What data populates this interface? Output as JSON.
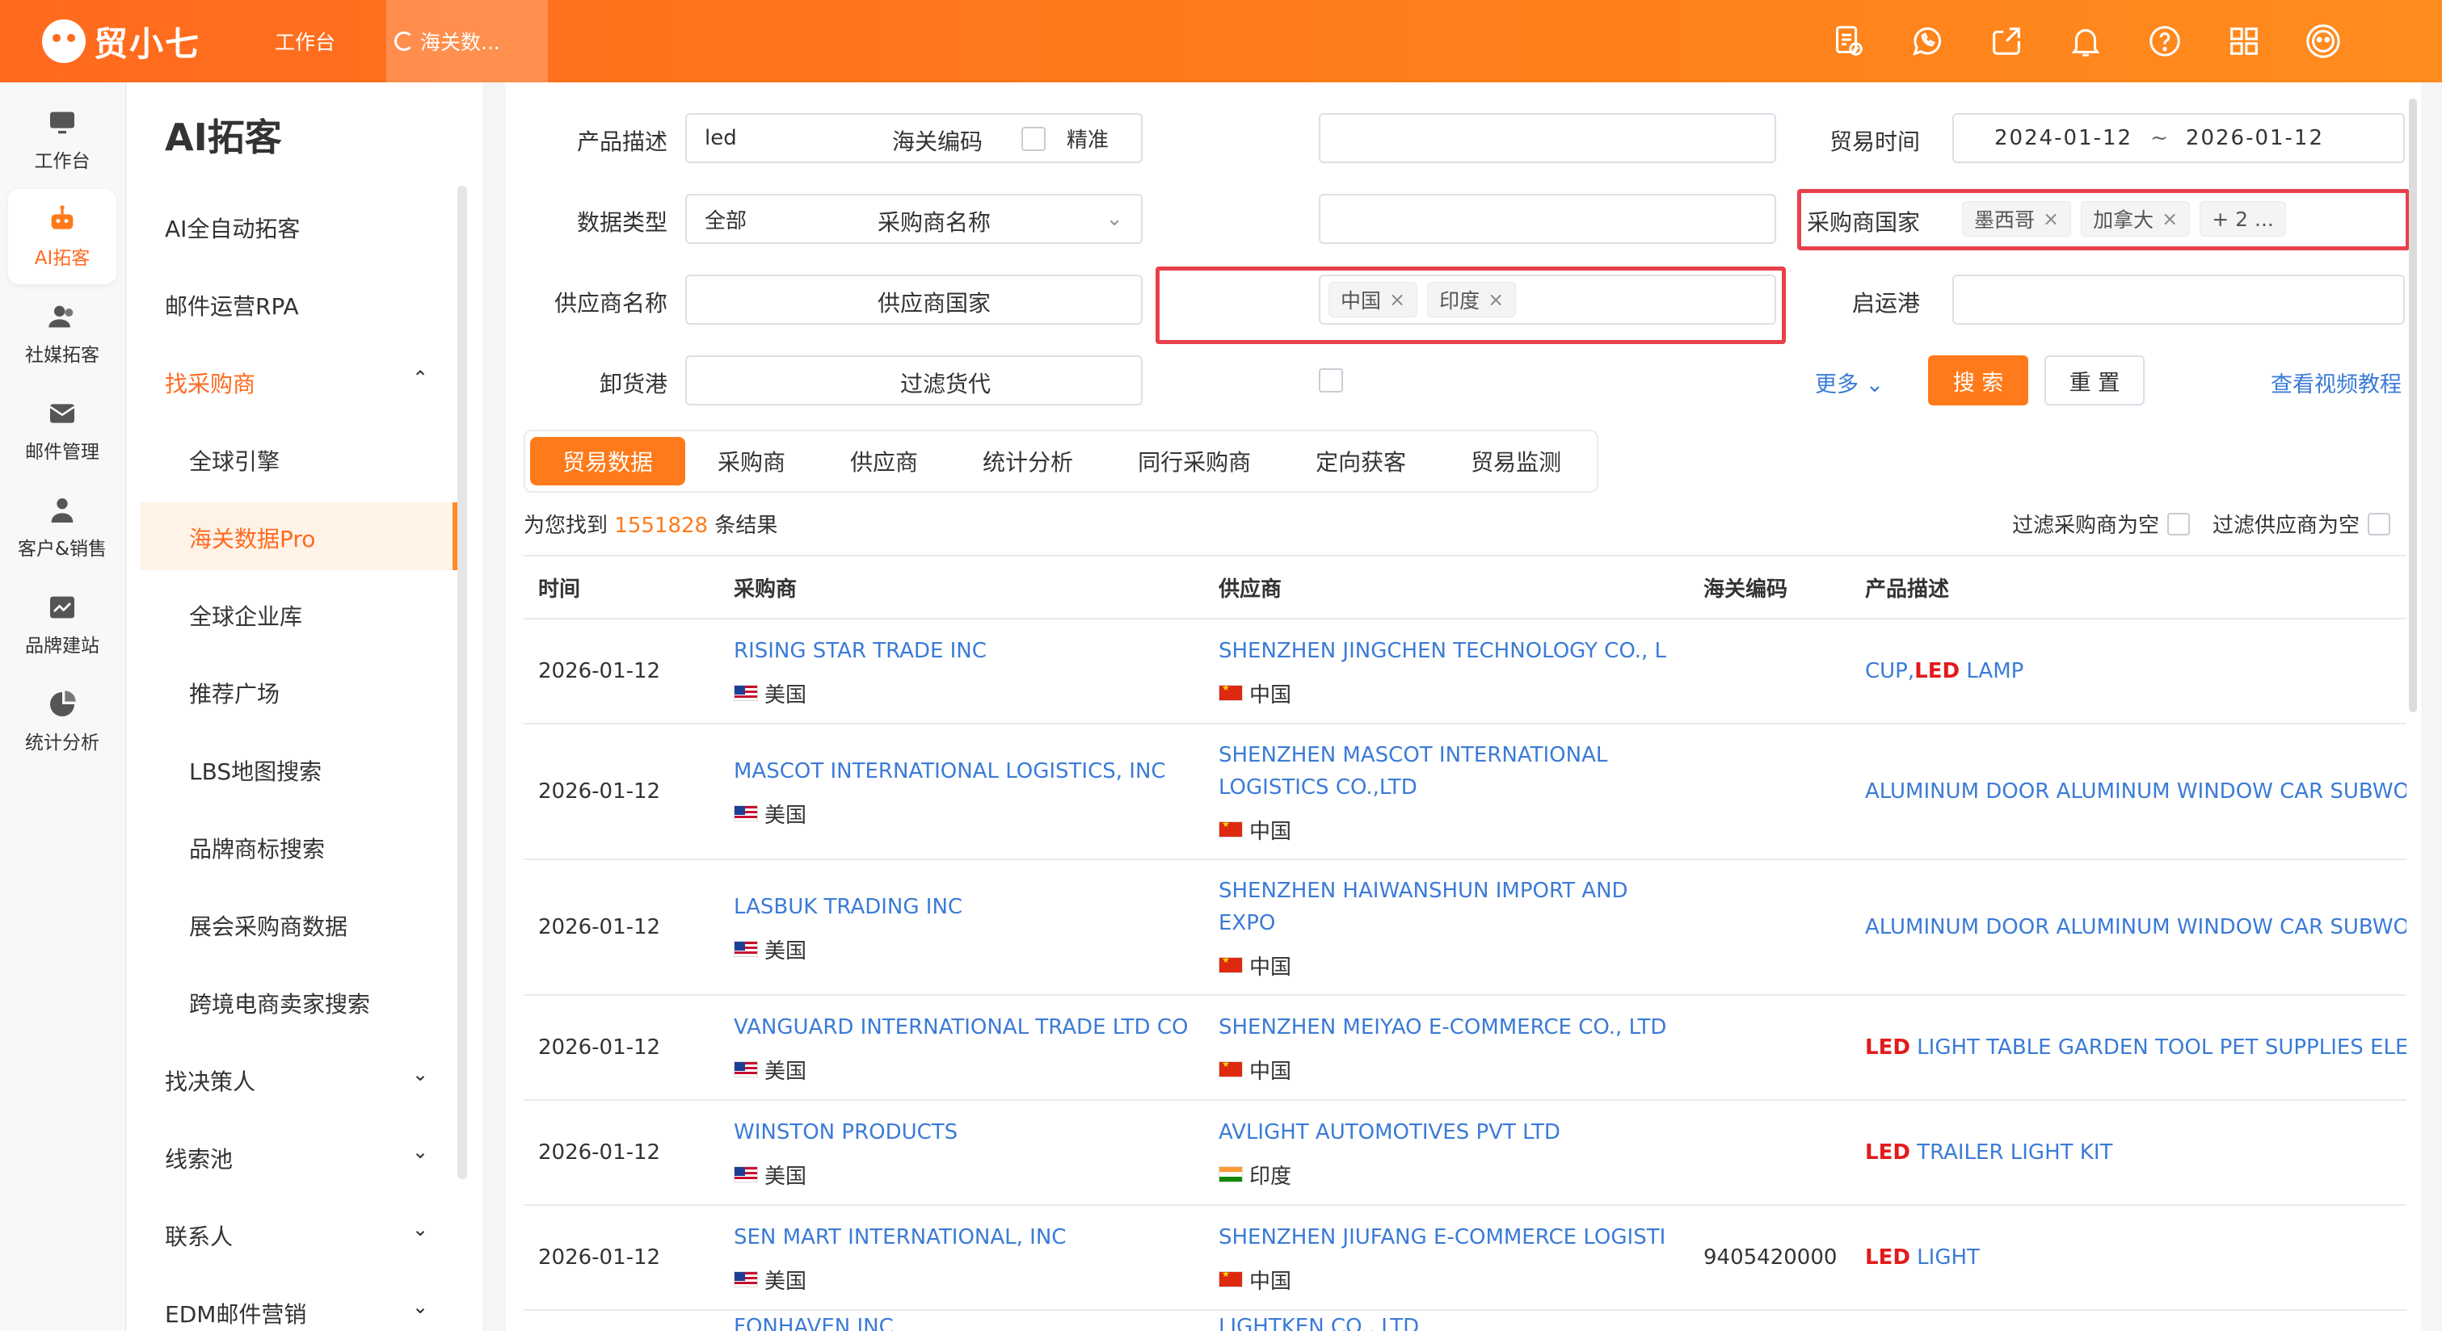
{
  "app": {
    "brand": "贸小七",
    "tabs": [
      "工作台",
      "海关数..."
    ]
  },
  "colors": {
    "accent": "#ff7a1a",
    "link": "#3b7bd6",
    "highlight": "#e21b1b",
    "redbox": "#e8414b"
  },
  "topbar_icons": [
    "document-check-icon",
    "whatsapp-icon",
    "share-icon",
    "bell-icon",
    "help-icon",
    "grid-apps-icon",
    "avatar-icon"
  ],
  "rail": [
    {
      "label": "工作台",
      "icon": "monitor-icon"
    },
    {
      "label": "AI拓客",
      "icon": "robot-icon",
      "active": true
    },
    {
      "label": "社媒拓客",
      "icon": "users-icon"
    },
    {
      "label": "邮件管理",
      "icon": "mail-icon"
    },
    {
      "label": "客户&销售",
      "icon": "customer-icon"
    },
    {
      "label": "品牌建站",
      "icon": "site-icon"
    },
    {
      "label": "统计分析",
      "icon": "pie-chart-icon"
    }
  ],
  "subnav": {
    "title": "AI拓客",
    "items": [
      {
        "label": "AI全自动拓客"
      },
      {
        "label": "邮件运营RPA"
      },
      {
        "label": "找采购商",
        "expanded": true
      },
      {
        "label": "全球引擎"
      },
      {
        "label": "海关数据Pro"
      },
      {
        "label": "全球企业库"
      },
      {
        "label": "推荐广场"
      },
      {
        "label": "LBS地图搜索"
      },
      {
        "label": "品牌商标搜索"
      },
      {
        "label": "展会采购商数据"
      },
      {
        "label": "跨境电商卖家搜索"
      },
      {
        "label": "找决策人"
      },
      {
        "label": "线索池"
      },
      {
        "label": "联系人"
      },
      {
        "label": "EDM邮件营销"
      }
    ]
  },
  "filters": {
    "product_desc": {
      "label": "产品描述",
      "value": "led",
      "exact_label": "精准"
    },
    "hs_code": {
      "label": "海关编码",
      "value": ""
    },
    "trade_time": {
      "label": "贸易时间",
      "start": "2024-01-12",
      "sep": "~",
      "end": "2026-01-12"
    },
    "data_type": {
      "label": "数据类型",
      "value": "全部"
    },
    "buyer_name": {
      "label": "采购商名称",
      "value": ""
    },
    "buyer_country": {
      "label": "采购商国家",
      "tags": [
        "墨西哥",
        "加拿大"
      ],
      "more": "+ 2 ..."
    },
    "supplier_name": {
      "label": "供应商名称",
      "value": ""
    },
    "supplier_country": {
      "label": "供应商国家",
      "tags": [
        "中国",
        "印度"
      ]
    },
    "departure_port": {
      "label": "启运港",
      "value": ""
    },
    "unloading_port": {
      "label": "卸货港",
      "value": ""
    },
    "filter_forwarder": {
      "label": "过滤货代"
    },
    "more": "更多",
    "search": "搜 索",
    "reset": "重 置",
    "video": "查看视频教程"
  },
  "tabs": [
    "贸易数据",
    "采购商",
    "供应商",
    "统计分析",
    "同行采购商",
    "定向获客",
    "贸易监测"
  ],
  "result": {
    "prefix": "为您找到",
    "count": "1551828",
    "suffix": "条结果"
  },
  "filter_empty": {
    "buyer": "过滤采购商为空",
    "supplier": "过滤供应商为空"
  },
  "table": {
    "headers": [
      "时间",
      "采购商",
      "供应商",
      "海关编码",
      "产品描述"
    ],
    "rows": [
      {
        "date": "2026-01-12",
        "buyer": "RISING STAR TRADE INC",
        "buyer_country": "美国",
        "buyer_flag": "us",
        "supplier": "SHENZHEN JINGCHEN TECHNOLOGY CO., L",
        "supplier_country": "中国",
        "supplier_flag": "cn",
        "hs": "",
        "desc": [
          {
            "t": "CUP,",
            "hl": false
          },
          {
            "t": "LED",
            "hl": true
          },
          {
            "t": " LAMP",
            "hl": false
          }
        ]
      },
      {
        "date": "2026-01-12",
        "buyer": "MASCOT INTERNATIONAL LOGISTICS, INC",
        "buyer_country": "美国",
        "buyer_flag": "us",
        "supplier": "SHENZHEN MASCOT INTERNATIONAL LOGISTICS CO.,LTD",
        "supplier_country": "中国",
        "supplier_flag": "cn",
        "hs": "",
        "desc": [
          {
            "t": "ALUMINUM DOOR ALUMINUM WINDOW CAR SUBWOO",
            "hl": false
          }
        ]
      },
      {
        "date": "2026-01-12",
        "buyer": "LASBUK TRADING INC",
        "buyer_country": "美国",
        "buyer_flag": "us",
        "supplier": "SHENZHEN HAIWANSHUN IMPORT AND EXPO",
        "supplier_country": "中国",
        "supplier_flag": "cn",
        "hs": "",
        "desc": [
          {
            "t": "ALUMINUM DOOR ALUMINUM WINDOW CAR SUBWOO",
            "hl": false
          }
        ]
      },
      {
        "date": "2026-01-12",
        "buyer": "VANGUARD INTERNATIONAL TRADE LTD CO",
        "buyer_country": "美国",
        "buyer_flag": "us",
        "supplier": "SHENZHEN MEIYAO E-COMMERCE CO., LTD",
        "supplier_country": "中国",
        "supplier_flag": "cn",
        "hs": "",
        "desc": [
          {
            "t": "LED",
            "hl": true
          },
          {
            "t": " LIGHT TABLE GARDEN TOOL PET SUPPLIES ELEC",
            "hl": false
          }
        ]
      },
      {
        "date": "2026-01-12",
        "buyer": "WINSTON PRODUCTS",
        "buyer_country": "美国",
        "buyer_flag": "us",
        "supplier": "AVLIGHT AUTOMOTIVES PVT LTD",
        "supplier_country": "印度",
        "supplier_flag": "in",
        "hs": "",
        "desc": [
          {
            "t": "LED",
            "hl": true
          },
          {
            "t": " TRAILER LIGHT KIT",
            "hl": false
          }
        ]
      },
      {
        "date": "2026-01-12",
        "buyer": "SEN MART INTERNATIONAL, INC",
        "buyer_country": "美国",
        "buyer_flag": "us",
        "supplier": "SHENZHEN JIUFANG E-COMMERCE LOGISTI",
        "supplier_country": "中国",
        "supplier_flag": "cn",
        "hs": "9405420000",
        "desc": [
          {
            "t": "LED",
            "hl": true
          },
          {
            "t": " LIGHT",
            "hl": false
          }
        ]
      },
      {
        "date": "",
        "buyer": "FONHAVEN INC",
        "buyer_country": "",
        "buyer_flag": "",
        "supplier": "LIGHTKEN CO., LTD",
        "supplier_country": "",
        "supplier_flag": "",
        "hs": "",
        "desc": []
      }
    ]
  }
}
